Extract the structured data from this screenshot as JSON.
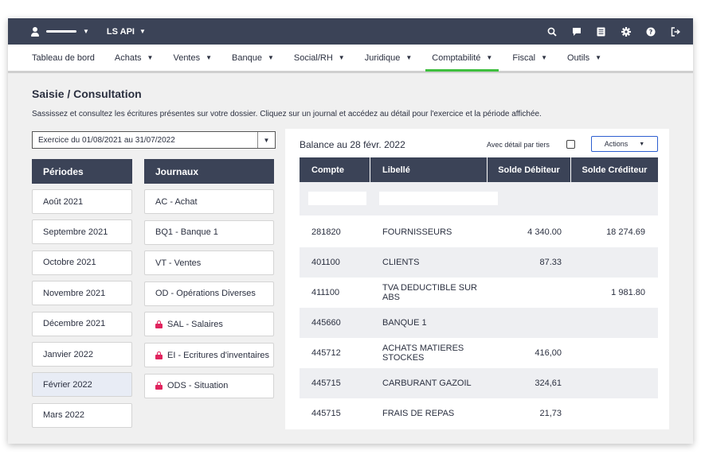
{
  "topbar": {
    "company": "LS API",
    "icons": [
      "search-icon",
      "chat-icon",
      "document-icon",
      "gear-icon",
      "help-icon",
      "logout-icon"
    ]
  },
  "nav": {
    "items": [
      {
        "label": "Tableau de bord",
        "has_caret": false,
        "active": false
      },
      {
        "label": "Achats",
        "has_caret": true,
        "active": false
      },
      {
        "label": "Ventes",
        "has_caret": true,
        "active": false
      },
      {
        "label": "Banque",
        "has_caret": true,
        "active": false
      },
      {
        "label": "Social/RH",
        "has_caret": true,
        "active": false
      },
      {
        "label": "Juridique",
        "has_caret": true,
        "active": false
      },
      {
        "label": "Comptabilité",
        "has_caret": true,
        "active": true
      },
      {
        "label": "Fiscal",
        "has_caret": true,
        "active": false
      },
      {
        "label": "Outils",
        "has_caret": true,
        "active": false
      }
    ]
  },
  "page": {
    "title": "Saisie / Consultation",
    "description": "Sassissez et consultez les écritures présentes sur votre dossier. Cliquez sur un journal et accédez au détail pour l'exercice et la période affichée."
  },
  "exercise": {
    "selected": "Exercice du 01/08/2021 au 31/07/2022"
  },
  "periods": {
    "header": "Périodes",
    "items": [
      "Août 2021",
      "Septembre 2021",
      "Octobre 2021",
      "Novembre 2021",
      "Décembre 2021",
      "Janvier 2022",
      "Février 2022",
      "Mars 2022"
    ],
    "selected_index": 6
  },
  "journals": {
    "header": "Journaux",
    "items": [
      {
        "label": "AC - Achat",
        "locked": false
      },
      {
        "label": "BQ1 - Banque 1",
        "locked": false
      },
      {
        "label": "VT - Ventes",
        "locked": false
      },
      {
        "label": "OD - Opérations Diverses",
        "locked": false
      },
      {
        "label": "SAL - Salaires",
        "locked": true
      },
      {
        "label": "EI - Ecritures d'inventaires",
        "locked": true
      },
      {
        "label": "ODS - Situation",
        "locked": true
      }
    ]
  },
  "balance": {
    "title": "Balance au 28 févr. 2022",
    "detail_label": "Avec détail par tiers",
    "actions_label": "Actions",
    "columns": [
      "Compte",
      "Libellé",
      "Solde Débiteur",
      "Solde Créditeur"
    ],
    "rows": [
      {
        "compte": "281820",
        "libelle": "FOURNISSEURS",
        "debit": "4 340.00",
        "credit": "18 274.69"
      },
      {
        "compte": "401100",
        "libelle": "CLIENTS",
        "debit": "87.33",
        "credit": ""
      },
      {
        "compte": "411100",
        "libelle": "TVA DEDUCTIBLE SUR ABS",
        "debit": "",
        "credit": "1 981.80"
      },
      {
        "compte": "445660",
        "libelle": "BANQUE 1",
        "debit": "",
        "credit": ""
      },
      {
        "compte": "445712",
        "libelle": "ACHATS MATIERES STOCKES",
        "debit": "416,00",
        "credit": ""
      },
      {
        "compte": "445715",
        "libelle": "CARBURANT GAZOIL",
        "debit": "324,61",
        "credit": ""
      },
      {
        "compte": "445715",
        "libelle": "FRAIS DE REPAS",
        "debit": "21,73",
        "credit": ""
      }
    ]
  }
}
